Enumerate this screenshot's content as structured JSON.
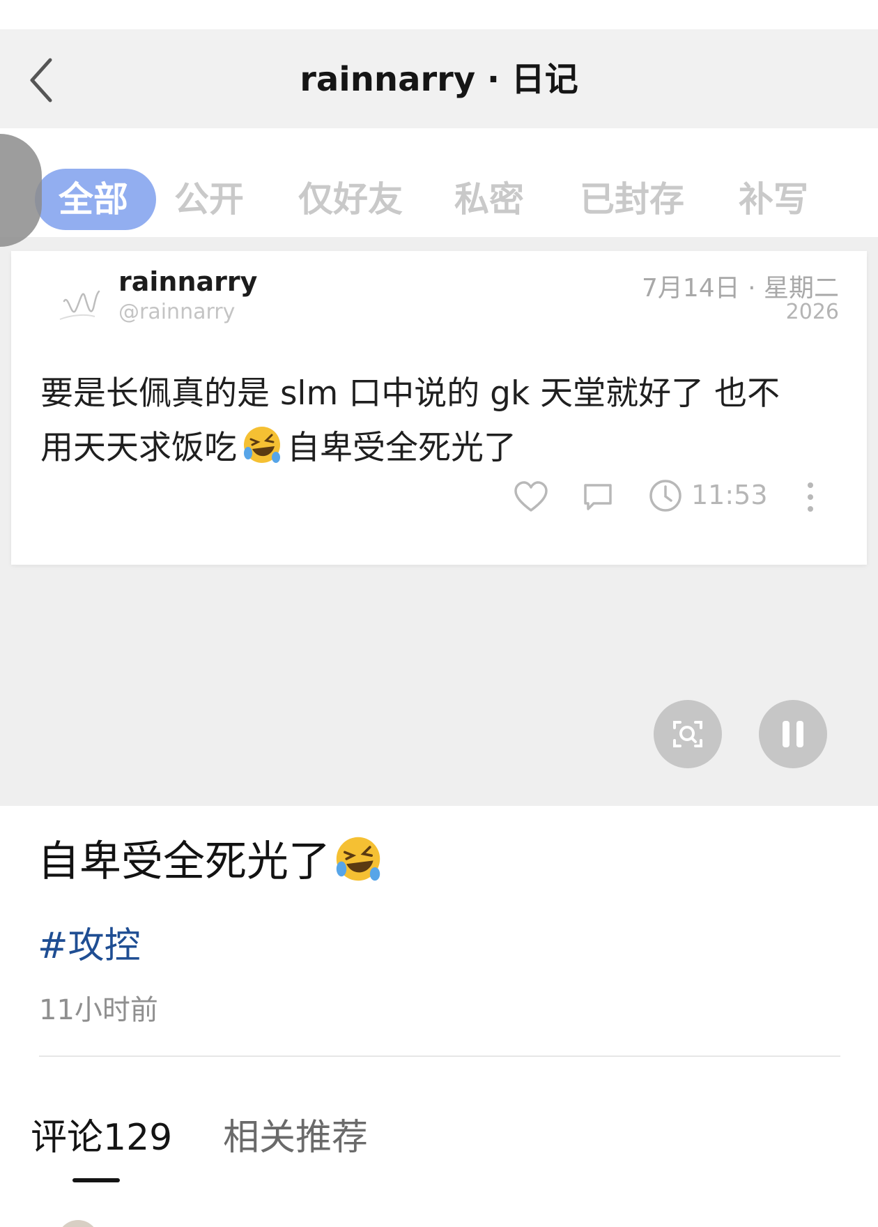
{
  "video": {
    "nav": {
      "back_icon": "chevron-left-icon",
      "title": "rainnarry · 日记"
    },
    "tabs": [
      {
        "label": "全部",
        "active": true
      },
      {
        "label": "公开",
        "active": false
      },
      {
        "label": "仅好友",
        "active": false
      },
      {
        "label": "私密",
        "active": false
      },
      {
        "label": "已封存",
        "active": false
      },
      {
        "label": "补写",
        "active": false
      }
    ],
    "side_handle_icon": "chevron-right-icon",
    "diary": {
      "username": "rainnarry",
      "handle": "@rainnarry",
      "date": "7月14日 · 星期二",
      "year": "2026",
      "body_line1": "要是长佩真的是 slm 口中说的 gk 天堂就好了 也不",
      "body_line2_before": "用天天求饭吃",
      "body_line2_after": "自卑受全死光了",
      "emoji": "rolling-on-floor-laughing-emoji",
      "time": "11:53",
      "icons": [
        "heart-icon",
        "comment-icon",
        "clock-icon",
        "more-vertical-icon"
      ]
    },
    "controls": {
      "scan_icon": "scan-icon",
      "pause_icon": "pause-icon"
    }
  },
  "post": {
    "title": "自卑受全死光了",
    "title_emoji": "rolling-on-floor-laughing-emoji",
    "hashtag": "#攻控",
    "timestamp": "11小时前"
  },
  "bottom_tabs": [
    {
      "label": "评论129",
      "active": true
    },
    {
      "label": "相关推荐",
      "active": false
    }
  ],
  "colors": {
    "active_tab_bg": "#92aef0",
    "hashtag": "#1f4e93",
    "inactive_tab_text": "#c9c9c9"
  }
}
